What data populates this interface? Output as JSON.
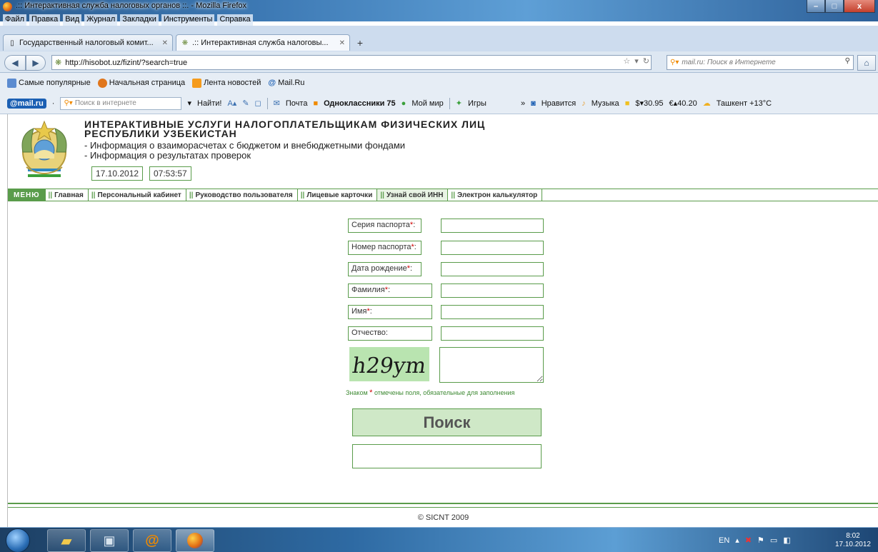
{
  "window": {
    "title": ".:: Интерактивная служба налоговых органов ::. - Mozilla Firefox",
    "controls": {
      "minimize": "–",
      "maximize": "□",
      "close": "x"
    }
  },
  "menubar": [
    "Файл",
    "Правка",
    "Вид",
    "Журнал",
    "Закладки",
    "Инструменты",
    "Справка"
  ],
  "tabs": [
    {
      "label": "Государственный налоговый комит...",
      "active": false
    },
    {
      "label": ".:: Интерактивная служба налоговы...",
      "active": true
    }
  ],
  "newtab_label": "+",
  "navbar": {
    "url": "http://hisobot.uz/fizint/?search=true",
    "search_placeholder": "mail.ru: Поиск в Интернете"
  },
  "bookmarks": [
    "Самые популярные",
    "Начальная страница",
    "Лента новостей",
    "Mail.Ru"
  ],
  "mailbar": {
    "logo": "@mail.ru",
    "search_placeholder": "Поиск в интернете",
    "find_label": "Найти!",
    "items": [
      "Почта",
      "Одноклассники 75",
      "Мой мир",
      "Игры"
    ],
    "right_items": [
      "Нравится",
      "Музыка",
      "$▾30.95",
      "€▴40.20",
      "Ташкент +13°C"
    ]
  },
  "header": {
    "title_line1": "ИНТЕРАКТИВНЫЕ УСЛУГИ НАЛОГОПЛАТЕЛЬЩИКАМ ФИЗИЧЕСКИХ ЛИЦ",
    "title_line2": "РЕСПУБЛИКИ УЗБЕКИСТАН",
    "desc_line1": "- Информация о взаиморасчетах с бюджетом и внебюджетными фондами",
    "desc_line2": "- Информация о результатах проверок",
    "date": "17.10.2012",
    "time": "07:53:57"
  },
  "site_menu": {
    "label": "МЕНЮ",
    "items": [
      {
        "label": "Главная",
        "active": false
      },
      {
        "label": "Персональный кабинет",
        "active": false
      },
      {
        "label": "Руководство пользователя",
        "active": false
      },
      {
        "label": "Лицевые карточки",
        "active": false
      },
      {
        "label": "Узнай свой ИНН",
        "active": true
      },
      {
        "label": "Электрон калькулятор",
        "active": false
      }
    ]
  },
  "form": {
    "fields": [
      {
        "label": "Серия паспорта",
        "required": true,
        "value": ""
      },
      {
        "label": "Номер паспорта",
        "required": true,
        "value": ""
      },
      {
        "label": "Дата рождение",
        "required": true,
        "value": ""
      },
      {
        "label": "Фамилия",
        "required": true,
        "value": ""
      },
      {
        "label": "Имя",
        "required": true,
        "value": ""
      },
      {
        "label": "Отчество:",
        "required": false,
        "value": ""
      }
    ],
    "required_marker": "*",
    "required_suffix": ":",
    "captcha_text": "h29ym",
    "note_before": "Знаком ",
    "note_after": " отмечены поля, обязательные для заполнения",
    "search_button": "Поиск"
  },
  "footer": {
    "copyright": "© SICNT 2009"
  },
  "taskbar": {
    "lang": "EN",
    "clock_time": "8:02",
    "clock_date": "17.10.2012"
  }
}
